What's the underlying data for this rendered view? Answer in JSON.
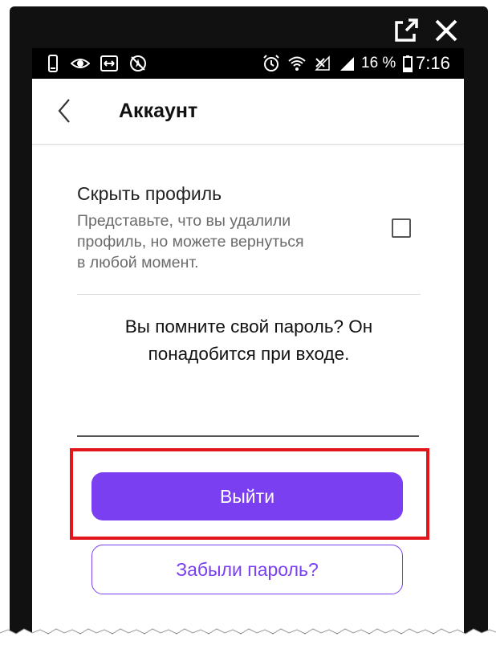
{
  "window": {
    "open_external_icon": "open-external-icon",
    "close_icon": "close-icon"
  },
  "status_bar": {
    "icons": [
      "phone-icon",
      "eye-icon",
      "screen-cast-icon",
      "location-off-icon",
      "alarm-icon",
      "wifi-icon",
      "signal-off-icon",
      "signal-icon",
      "battery-icon"
    ],
    "battery_percent": "16 %",
    "time": "7:16"
  },
  "app_bar": {
    "back_icon": "chevron-left-icon",
    "title": "Аккаунт"
  },
  "hide_profile": {
    "title": "Скрыть профиль",
    "description_lines": [
      "Представьте, что вы удалили",
      "профиль, но можете вернуться",
      "в любой момент."
    ],
    "checked": false
  },
  "password_prompt": {
    "lines": [
      "Вы помните свой пароль? Он",
      "понадобится при входе."
    ],
    "field_value": ""
  },
  "buttons": {
    "logout_label": "Выйти",
    "forgot_label": "Забыли пароль?"
  },
  "colors": {
    "accent": "#7b3ff2",
    "highlight": "#e0161b",
    "frame": "#111111"
  }
}
